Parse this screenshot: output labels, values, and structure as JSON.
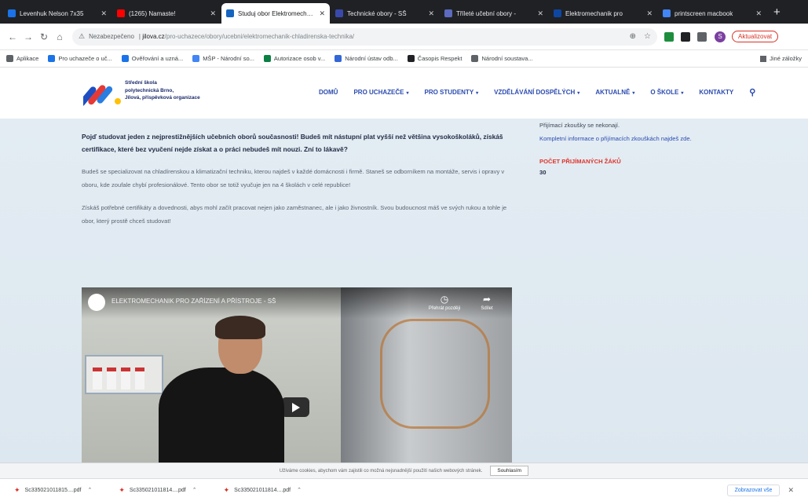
{
  "browser": {
    "tabs": [
      {
        "title": "Levenhuk Nelson 7x35",
        "color": "#1a73e8"
      },
      {
        "title": "(1265) Namaste!",
        "color": "#ff0000"
      },
      {
        "title": "Studuj obor Elektromechanik",
        "color": "#1565c0",
        "active": true
      },
      {
        "title": "Technické obory - SŠ",
        "color": "#3949ab"
      },
      {
        "title": "Tříleté učební obory -",
        "color": "#5c6bc0"
      },
      {
        "title": "Elektromechanik pro",
        "color": "#0d47a1"
      },
      {
        "title": "printscreen macbook",
        "color": "#4285f4"
      }
    ],
    "new_tab_label": "+",
    "address": {
      "insecure_label": "Nezabezpečeno",
      "host": "jilova.cz",
      "path": "/pro-uchazece/obory/ucebni/elektromechanik-chladirenska-technika/"
    },
    "profile_initial": "S",
    "update_label": "Aktualizovat",
    "bookmarks": [
      {
        "label": "Aplikace",
        "color": "#5f6368"
      },
      {
        "label": "Pro uchazeče o uč...",
        "color": "#1a73e8"
      },
      {
        "label": "Ověřování a uzná...",
        "color": "#1a73e8"
      },
      {
        "label": "MŠP - Národní so...",
        "color": "#4285f4"
      },
      {
        "label": "Autorizace osob v...",
        "color": "#0b8043"
      },
      {
        "label": "Národní ústav odb...",
        "color": "#3367d6"
      },
      {
        "label": "Časopis Respekt",
        "color": "#202124"
      },
      {
        "label": "Národní soustava...",
        "color": "#5f6368"
      }
    ],
    "other_bookmarks": "Jiné záložky"
  },
  "site": {
    "school_name_line1": "Střední škola",
    "school_name_line2": "polytechnická Brno,",
    "school_name_line3": "Jílová, příspěvková organizace",
    "nav": [
      "DOMŮ",
      "PRO UCHAZEČE",
      "PRO STUDENTY",
      "VZDĚLÁVÁNÍ DOSPĚLÝCH",
      "AKTUALNĚ",
      "O ŠKOLE",
      "KONTAKTY"
    ],
    "nav_dropdown": [
      false,
      true,
      true,
      true,
      true,
      true,
      false
    ],
    "intro": "Pojď studovat jeden z nejprestižnějších učebních oborů současnosti! Budeš mít nástupní plat vyšší než většina vysokoškoláků, získáš certifikace, které bez vyučení nejde získat a o práci nebudeš mít nouzi. Zní to lákavě?",
    "para1": "Budeš se specializovat na chladírenskou a klimatizační techniku, kterou najdeš v každé domácnosti i firmě. Staneš se odborníkem na montáže, servis i opravy v oboru, kde zoufale chybí profesionálové. Tento obor se totiž vyučuje jen na 4 školách v celé republice!",
    "para2": "Získáš potřebné certifikáty a dovednosti, abys mohl začít pracovat nejen jako zaměstnanec, ale i jako živnostník. Svou budoucnost máš ve svých rukou a tohle je obor, který prostě chceš studovat!",
    "video_title": "ELEKTROMECHANIK PRO ZAŘÍZENÍ A PŘÍSTROJE - SŠ",
    "video_watch_later": "Přehrát později",
    "video_share": "Sdílet",
    "side_line1": "Přijímací zkoušky se nekonají.",
    "side_link": "Kompletní informace o přijímacích zkouškách najdeš zde.",
    "side_heading": "POČET PŘIJÍMANÝCH ŽÁKŮ",
    "side_value": "30"
  },
  "cookie": {
    "text": "Užíváme cookies, abychom vám zajistili co možná nejsnadnější použití našich webových stránek.",
    "button": "Souhlasím"
  },
  "downloads": {
    "items": [
      {
        "name": "Sc335021011815....pdf"
      },
      {
        "name": "Sc335021011814....pdf"
      },
      {
        "name": "Sc335021011814....pdf"
      }
    ],
    "show_all": "Zobrazovat vše"
  }
}
